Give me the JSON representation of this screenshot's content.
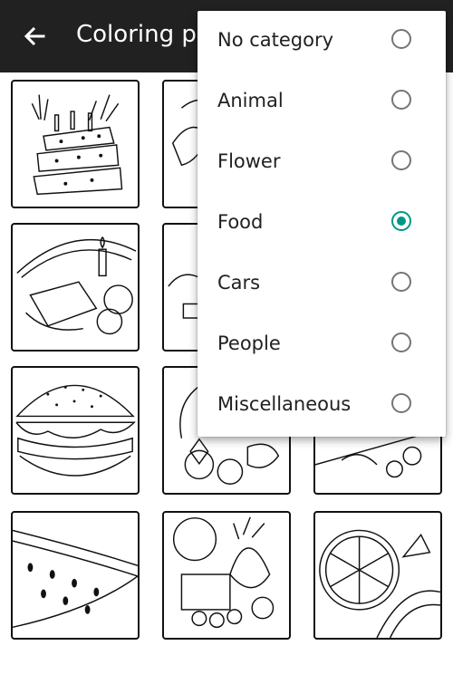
{
  "appbar": {
    "title": "Coloring pa",
    "back_icon": "arrow-back-icon"
  },
  "grid": {
    "tiles": [
      {
        "name": "birthday-cake"
      },
      {
        "name": "food-partial-1"
      },
      {
        "name": "cake-plate"
      },
      {
        "name": "food-partial-2"
      },
      {
        "name": "burger"
      },
      {
        "name": "fruit-basket"
      },
      {
        "name": "food-partial-3"
      },
      {
        "name": "watermelon"
      },
      {
        "name": "fruit-pile"
      },
      {
        "name": "orange-slices"
      }
    ]
  },
  "menu": {
    "items": [
      {
        "label": "No category",
        "checked": false
      },
      {
        "label": "Animal",
        "checked": false
      },
      {
        "label": "Flower",
        "checked": false
      },
      {
        "label": "Food",
        "checked": true
      },
      {
        "label": "Cars",
        "checked": false
      },
      {
        "label": "People",
        "checked": false
      },
      {
        "label": "Miscellaneous",
        "checked": false
      }
    ]
  },
  "colors": {
    "appbar": "#212121",
    "accent": "#009688",
    "radio_off": "#757575"
  }
}
